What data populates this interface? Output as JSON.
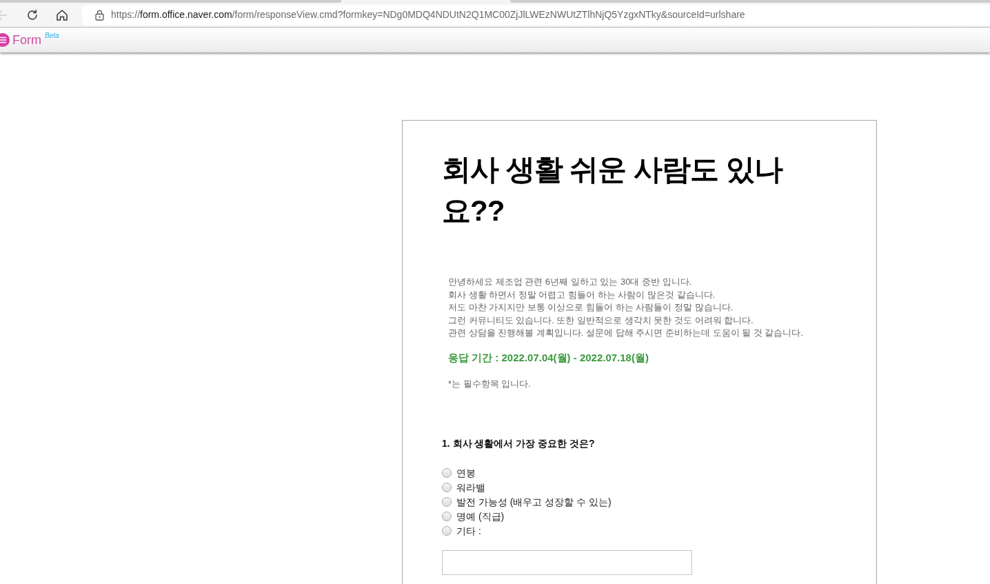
{
  "browser": {
    "back_disabled": true,
    "url": {
      "scheme": "https://",
      "host": "form.office.naver.com",
      "path": "/form/responseView.cmd?formkey=NDg0MDQ4NDUtN2Q1MC00ZjJlLWEzNWUtZTlhNjQ5YzgxNTky&sourceId=urlshare"
    }
  },
  "app_header": {
    "logo_text": "Form",
    "badge": "Beta"
  },
  "form": {
    "title": "회사 생활 쉬운 사람도 있나요??",
    "description": "안녕하세요 제조업 관련 6년째 일하고 있는 30대 중반 입니다.\n회사 생활 하면서 정말 어렵고 힘들어 하는 사람이 많은것 같습니다.\n저도 마찬 가지지만 보통 이상으로 힘들어 하는 사람들이 정말 많습니다.\n그런 커뮤니티도 있습니다. 또한 일반적으로 생각치 못한 것도 어려워 합니다.\n관련 상담을 진행해볼 계획입니다. 설문에 답해 주시면 준비하는데 도움이 될 것 같습니다.",
    "period": "응답 기간 : 2022.07.04(월) - 2022.07.18(월)",
    "required_note": "*는 필수항목 입니다.",
    "questions": [
      {
        "title": "1. 회사 생활에서 가장 중요한 것은?",
        "options": [
          {
            "label": "연봉",
            "kind": "choice",
            "selected": false
          },
          {
            "label": "워라밸",
            "kind": "choice",
            "selected": false
          },
          {
            "label": "발전 가능성 (배우고 성장할 수 있는)",
            "kind": "choice",
            "selected": false
          },
          {
            "label": "명예 (직급)",
            "kind": "choice",
            "selected": false
          },
          {
            "label": "기타 :",
            "kind": "other",
            "selected": false
          }
        ]
      }
    ]
  }
}
